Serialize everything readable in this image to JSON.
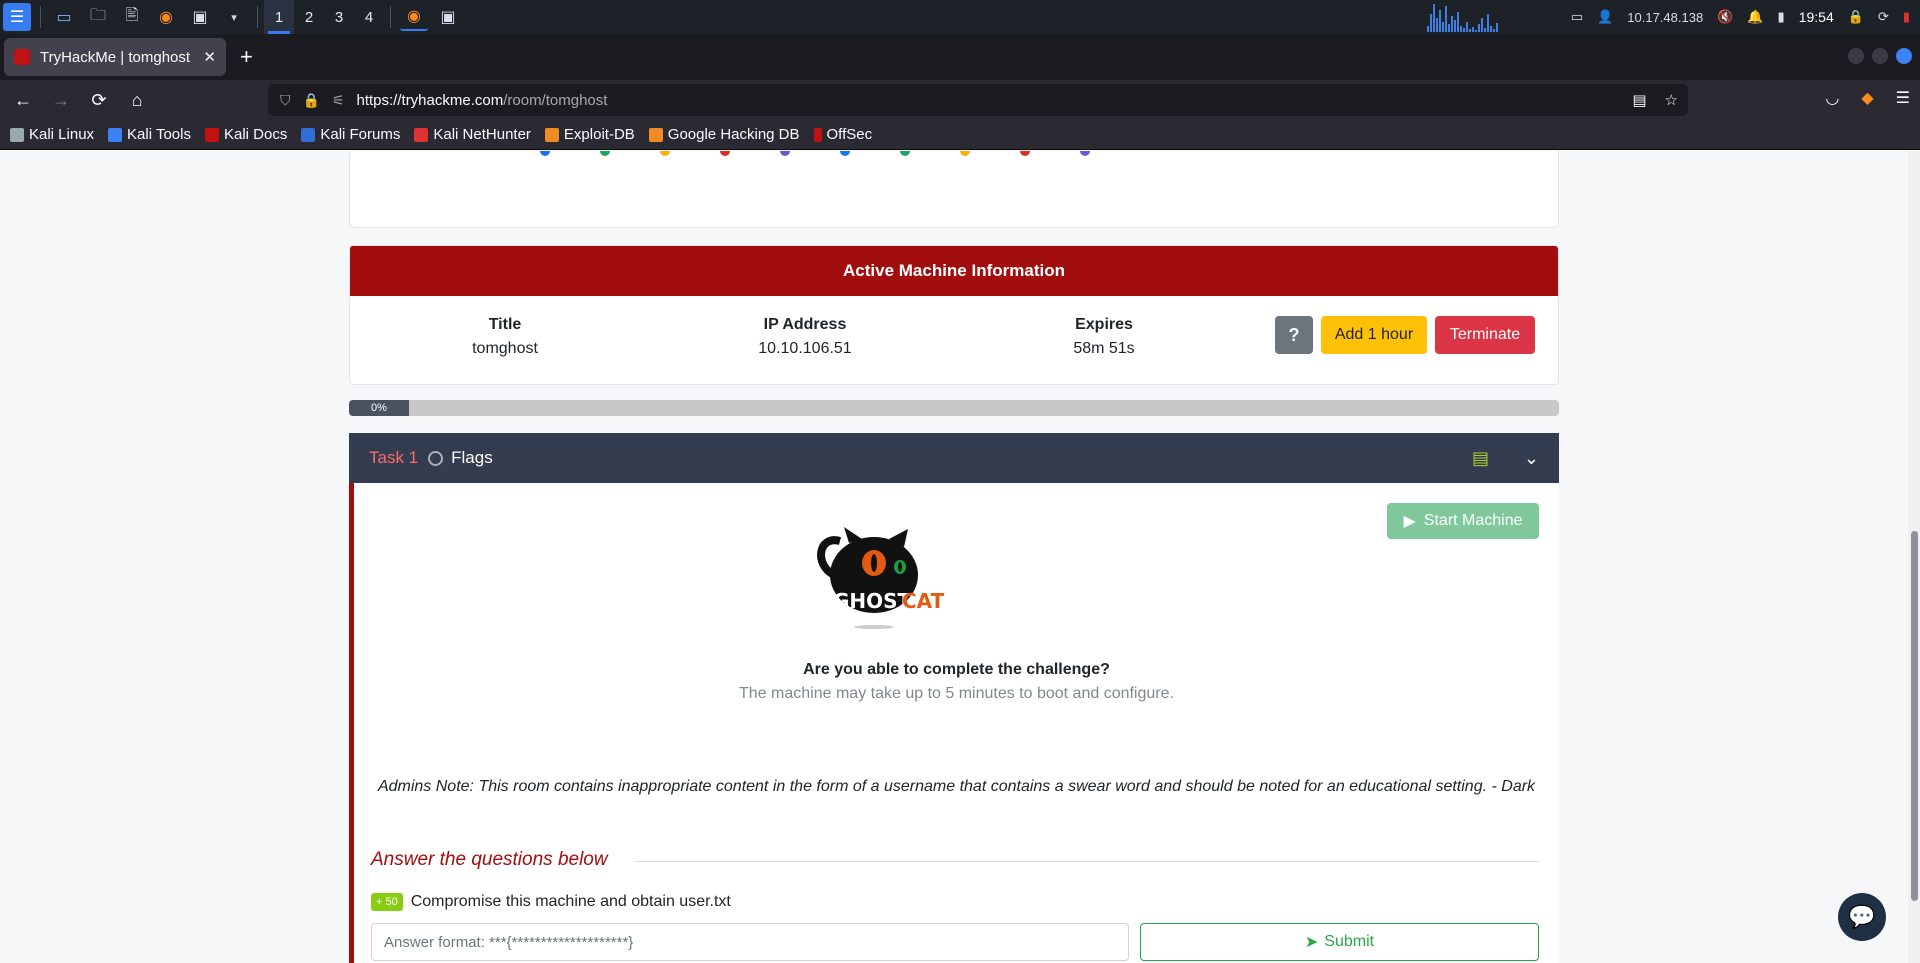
{
  "taskbar": {
    "workspaces": [
      "1",
      "2",
      "3",
      "4"
    ],
    "ip": "10.17.48.138",
    "time": "19:54"
  },
  "browser": {
    "tab_title": "TryHackMe | tomghost",
    "url_host": "https://tryhackme.com",
    "url_path": "/room/tomghost",
    "bookmarks": [
      "Kali Linux",
      "Kali Tools",
      "Kali Docs",
      "Kali Forums",
      "Kali NetHunter",
      "Exploit-DB",
      "Google Hacking DB",
      "OffSec"
    ]
  },
  "machine": {
    "header": "Active Machine Information",
    "title_label": "Title",
    "title_value": "tomghost",
    "ip_label": "IP Address",
    "ip_value": "10.10.106.51",
    "expires_label": "Expires",
    "expires_value": "58m 51s",
    "help_label": "?",
    "add_hour_label": "Add 1 hour",
    "terminate_label": "Terminate"
  },
  "progress": {
    "label": "0%",
    "value": 0
  },
  "task": {
    "number": "Task 1",
    "title": "Flags",
    "start_label": "Start Machine",
    "logo_text_a": "GHOST",
    "logo_text_b": "CAT",
    "challenge": "Are you able to complete the challenge?",
    "challenge_sub": "The machine may take up to 5 minutes to boot and configure.",
    "admin_note": "Admins Note: This room contains inappropriate content in the form of a username that contains a swear word and should be noted for an educational setting. - Dark",
    "answer_heading": "Answer the questions below",
    "question_points": "+ 50",
    "question_text": "Compromise this machine and obtain user.txt",
    "answer_placeholder": "Answer format: ***{********************}",
    "submit_label": "Submit"
  }
}
